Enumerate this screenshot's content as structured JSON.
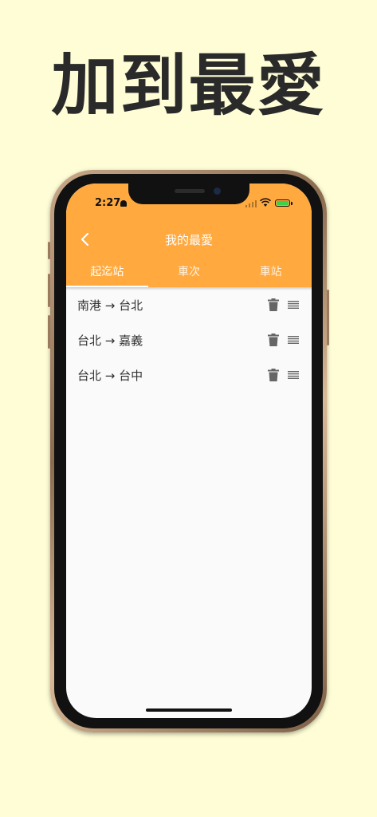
{
  "promo": {
    "headline": "加到最愛"
  },
  "status_bar": {
    "time": "2:27"
  },
  "app_bar": {
    "title": "我的最愛",
    "tabs": [
      {
        "label": "起迄站",
        "active": true
      },
      {
        "label": "車次",
        "active": false
      },
      {
        "label": "車站",
        "active": false
      }
    ]
  },
  "favorites": [
    {
      "label": "南港 → 台北"
    },
    {
      "label": "台北 → 嘉義"
    },
    {
      "label": "台北 → 台中"
    }
  ],
  "colors": {
    "accent": "#FFA93F",
    "background": "#FEFDD6",
    "list_bg": "#FAFAFA"
  },
  "icons": [
    "back-arrow-icon",
    "trash-icon",
    "drag-handle-icon",
    "bell-muted-icon",
    "wifi-icon",
    "battery-icon",
    "signal-icon"
  ]
}
